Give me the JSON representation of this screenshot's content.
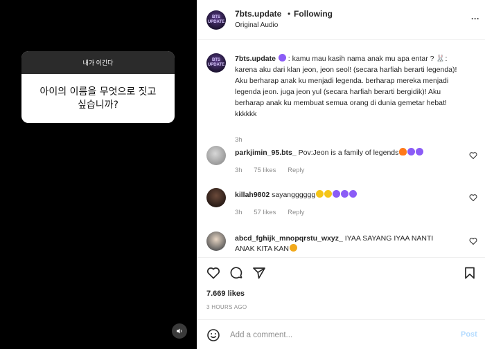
{
  "story": {
    "question_header": "내가 이긴다",
    "question_text": "아이의 이름을 무엇으로 짓고 싶습니까?"
  },
  "header": {
    "username": "7bts.update",
    "dot": "•",
    "follow_label": "Following",
    "audio": "Original Audio",
    "avatar_text": "BTS UPDATE",
    "more": "···"
  },
  "caption": {
    "username": "7bts.update",
    "text": ": kamu mau kasih nama anak mu apa entar ? 🐰: karena aku dari klan jeon, jeon seol! (secara harfiah berarti legenda)! Aku berharap anak ku menjadi legenda. berharap mereka menjadi legenda jeon. juga jeon yul (secara harfiah berarti bergidik)! Aku berharap anak ku membuat semua orang di dunia gemetar hebat! kkkkkk",
    "time": "3h"
  },
  "comments": [
    {
      "username": "parkjimin_95.bts_",
      "text": "Pov:Jeon is a family of legends",
      "time": "3h",
      "likes": "75 likes",
      "reply": "Reply",
      "emojis": [
        "fire",
        "purple",
        "purple"
      ]
    },
    {
      "username": "killah9802",
      "text": "sayangggggg",
      "time": "3h",
      "likes": "57 likes",
      "reply": "Reply",
      "emojis": [
        "yellow",
        "yellow",
        "purple",
        "purple",
        "purple"
      ]
    },
    {
      "username": "abcd_fghijk_mnopqrstu_wxyz_",
      "text": "IYAA SAYANG IYAA NANTI",
      "text2": "ANAK KITA KAN",
      "time": "",
      "likes": "",
      "reply": "",
      "emojis": [
        "yellow"
      ]
    }
  ],
  "actions": {
    "likes": "7.669 likes",
    "time_ago": "3 HOURS AGO"
  },
  "add_comment": {
    "placeholder": "Add a comment...",
    "post_label": "Post"
  },
  "colors": {
    "accent": "#0095f6",
    "post_disabled": "#b3dbff",
    "muted": "#8e8e8e",
    "emoji_purple": "#8b5cf6"
  }
}
